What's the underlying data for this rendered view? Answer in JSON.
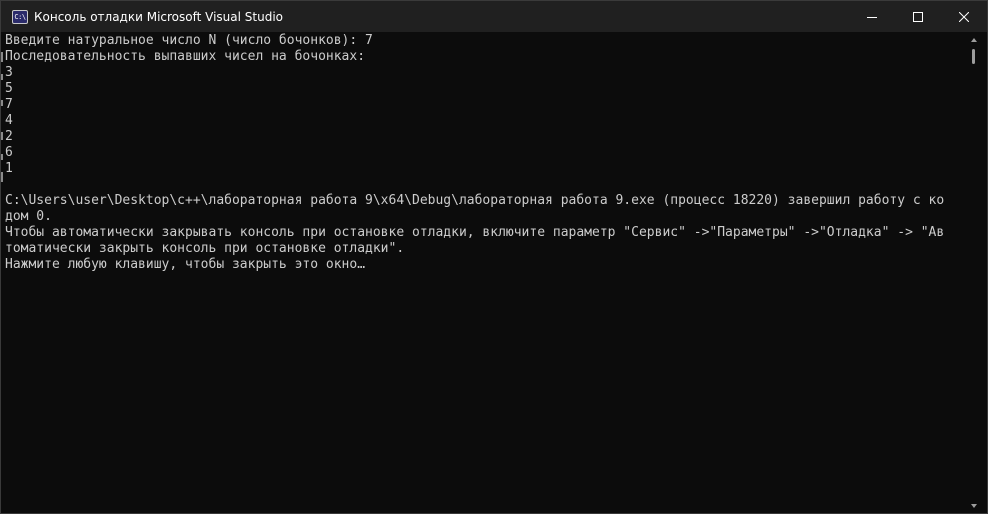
{
  "window": {
    "title": "Консоль отладки Microsoft Visual Studio",
    "icon_label": "C:\\"
  },
  "icons": {
    "app": "console-app-icon",
    "minimize": "minimize-icon",
    "maximize": "maximize-icon",
    "close": "close-icon"
  },
  "colors": {
    "console_background": "#0c0c0c",
    "console_text": "#cccccc",
    "titlebar_background": "#202020"
  },
  "console": {
    "lines": [
      "Введите натуральное число N (число бочонков): 7",
      "Последовательность выпавших чисел на бочонках:",
      "3",
      "5",
      "7",
      "4",
      "2",
      "6",
      "1",
      "",
      "C:\\Users\\user\\Desktop\\c++\\лабораторная работа 9\\x64\\Debug\\лабораторная работа 9.exe (процесс 18220) завершил работу с ко",
      "дом 0.",
      "Чтобы автоматически закрывать консоль при остановке отладки, включите параметр \"Сервис\" ->\"Параметры\" ->\"Отладка\" -> \"Ав",
      "томатически закрыть консоль при остановке отладки\".",
      "Нажмите любую клавишу, чтобы закрыть это окно…"
    ]
  }
}
